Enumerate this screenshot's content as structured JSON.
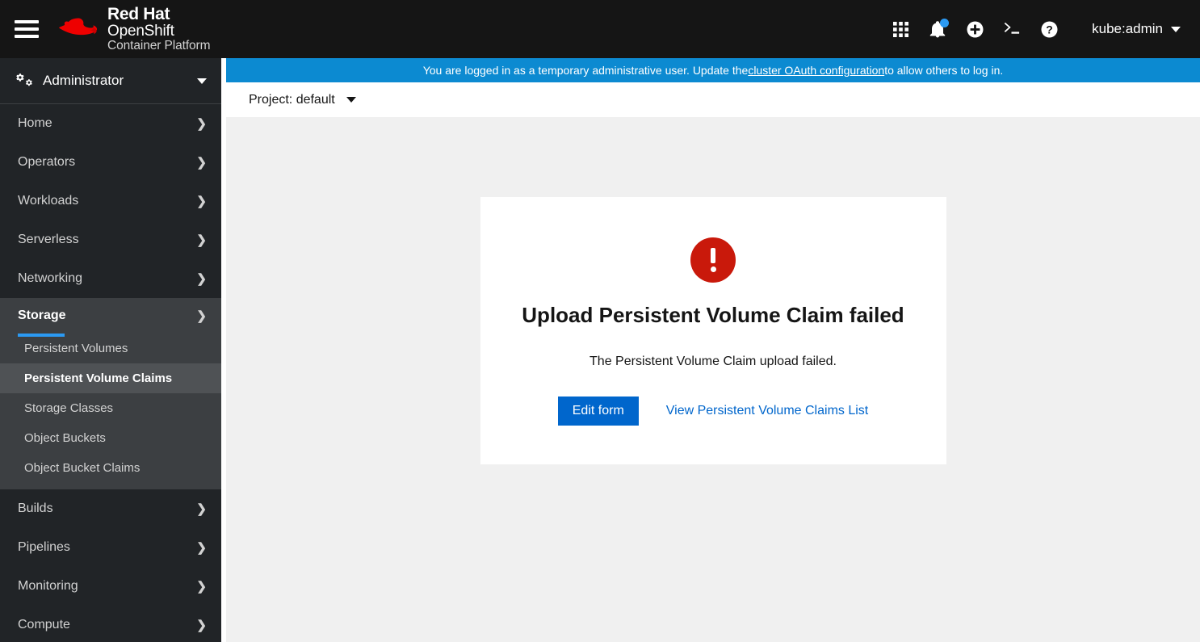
{
  "masthead": {
    "menu_icon": "hamburger-icon",
    "brand": {
      "line1": "Red Hat",
      "line2": "OpenShift",
      "line3": "Container Platform",
      "logo": "red-hat-fedora-logo"
    },
    "icons": [
      {
        "name": "application-launcher-icon",
        "glyph": "grid"
      },
      {
        "name": "notification-bell-icon",
        "glyph": "bell",
        "badge": true
      },
      {
        "name": "quick-add-icon",
        "glyph": "plus-circle"
      },
      {
        "name": "command-line-terminal-icon",
        "glyph": "terminal"
      },
      {
        "name": "help-icon",
        "glyph": "question-circle"
      }
    ],
    "user": "kube:admin"
  },
  "sidebar": {
    "perspective": {
      "label": "Administrator",
      "icon": "cogs-icon"
    },
    "items": [
      {
        "label": "Home",
        "expandable": true,
        "expanded": false
      },
      {
        "label": "Operators",
        "expandable": true,
        "expanded": false
      },
      {
        "label": "Workloads",
        "expandable": true,
        "expanded": false
      },
      {
        "label": "Serverless",
        "expandable": true,
        "expanded": false
      },
      {
        "label": "Networking",
        "expandable": true,
        "expanded": false
      },
      {
        "label": "Storage",
        "expandable": true,
        "expanded": true
      },
      {
        "label": "Builds",
        "expandable": true,
        "expanded": false
      },
      {
        "label": "Pipelines",
        "expandable": true,
        "expanded": false
      },
      {
        "label": "Monitoring",
        "expandable": true,
        "expanded": false
      },
      {
        "label": "Compute",
        "expandable": true,
        "expanded": false
      }
    ],
    "storage_children": [
      {
        "label": "Persistent Volumes",
        "active": false
      },
      {
        "label": "Persistent Volume Claims",
        "active": true
      },
      {
        "label": "Storage Classes",
        "active": false
      },
      {
        "label": "Object Buckets",
        "active": false
      },
      {
        "label": "Object Bucket Claims",
        "active": false
      }
    ]
  },
  "banner": {
    "text_before": "You are logged in as a temporary administrative user. Update the ",
    "link_text": "cluster OAuth configuration",
    "text_after": " to allow others to log in."
  },
  "project_bar": {
    "label": "Project: default"
  },
  "error_card": {
    "icon": "exclamation-circle-icon",
    "title": "Upload Persistent Volume Claim failed",
    "message": "The Persistent Volume Claim upload failed.",
    "primary_button": "Edit form",
    "secondary_link": "View Persistent Volume Claims List"
  },
  "colors": {
    "masthead_bg": "#151515",
    "sidebar_bg": "#212427",
    "sidebar_expanded_bg": "#3c3f42",
    "sidebar_active_bg": "#4f5255",
    "accent_blue": "#2b9af3",
    "banner_blue": "#0c8ad1",
    "primary_button": "#0066cc",
    "link_blue": "#0066cc",
    "error_red": "#c9190b",
    "content_bg": "#f0f0f0"
  }
}
